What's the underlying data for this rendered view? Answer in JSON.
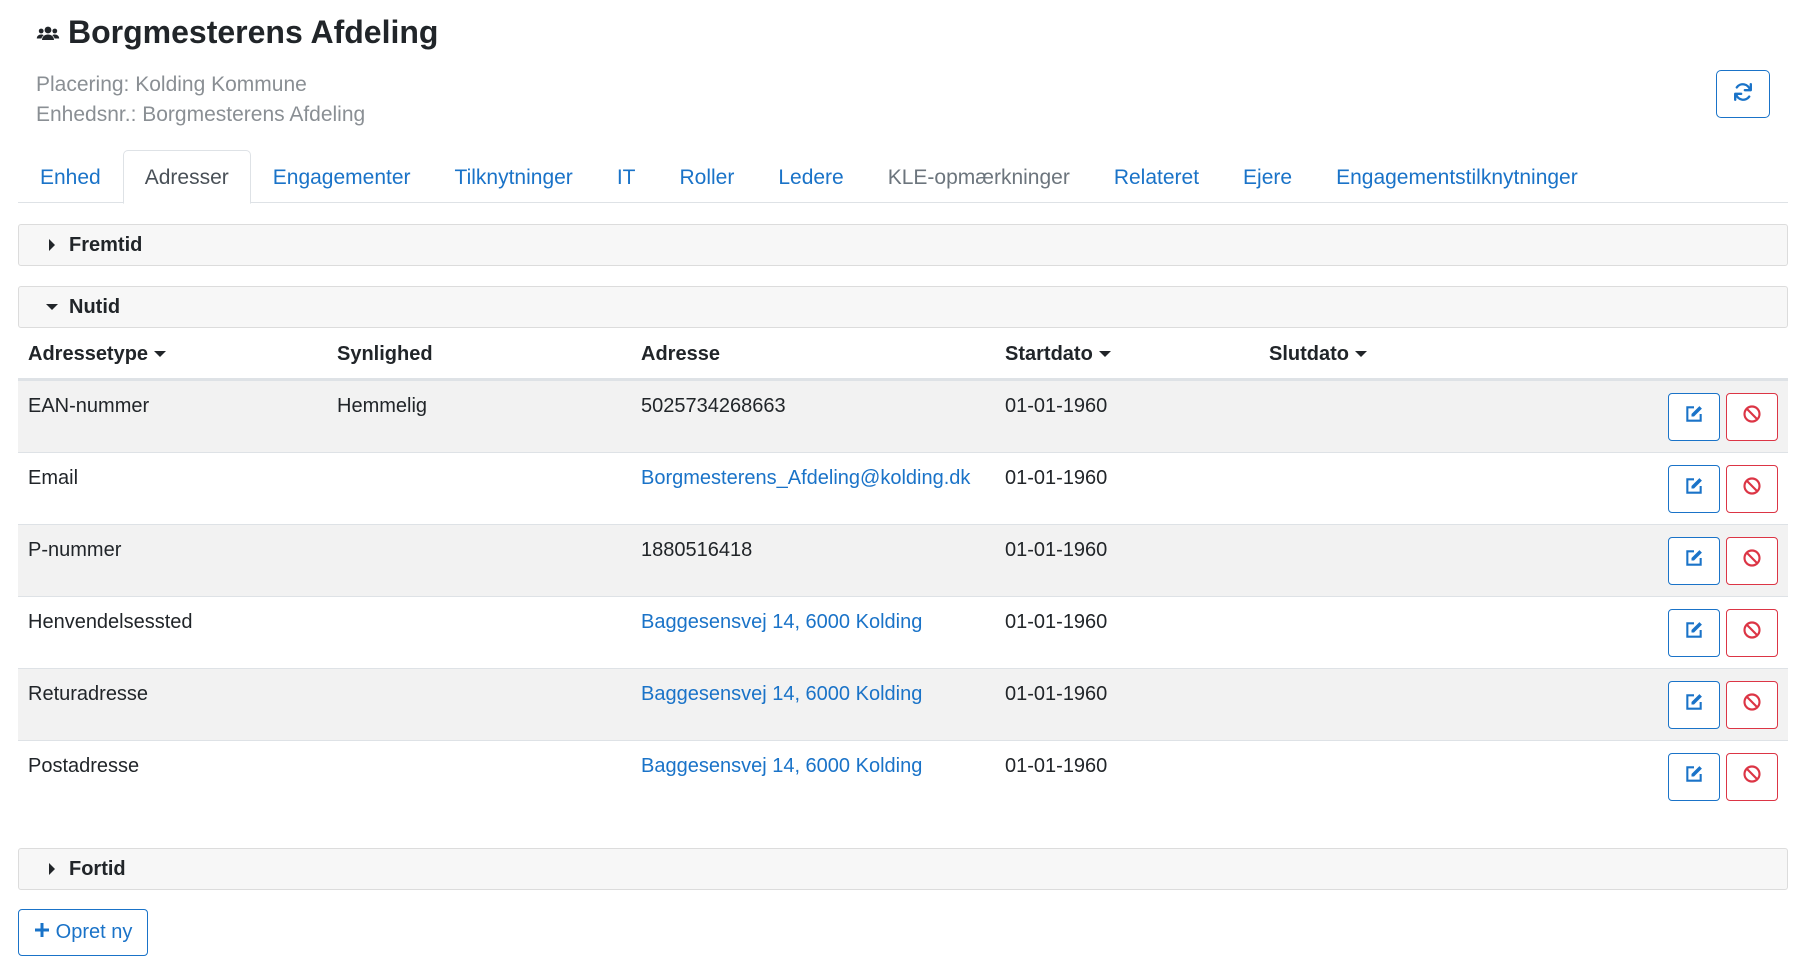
{
  "header": {
    "title": "Borgmesterens Afdeling",
    "placement": "Placering: Kolding Kommune",
    "unit_number": "Enhedsnr.: Borgmesterens Afdeling",
    "title_icon": "users-icon",
    "refresh_icon": "refresh-icon"
  },
  "tabs": [
    {
      "label": "Enhed"
    },
    {
      "label": "Adresser"
    },
    {
      "label": "Engagementer"
    },
    {
      "label": "Tilknytninger"
    },
    {
      "label": "IT"
    },
    {
      "label": "Roller"
    },
    {
      "label": "Ledere"
    },
    {
      "label": "KLE-opmærkninger"
    },
    {
      "label": "Relateret"
    },
    {
      "label": "Ejere"
    },
    {
      "label": "Engagementstilknytninger"
    }
  ],
  "active_tab": "Adresser",
  "sections": {
    "future": "Fremtid",
    "present": "Nutid",
    "past": "Fortid"
  },
  "table": {
    "headers": {
      "type": "Adressetype",
      "visibility": "Synlighed",
      "address": "Adresse",
      "start": "Startdato",
      "end": "Slutdato"
    },
    "rows": [
      {
        "type": "EAN-nummer",
        "visibility": "Hemmelig",
        "address": "5025734268663",
        "start": "01-01-1960",
        "end": ""
      },
      {
        "type": "Email",
        "visibility": "",
        "address": "Borgmesterens_Afdeling@kolding.dk",
        "start": "01-01-1960",
        "end": ""
      },
      {
        "type": "P-nummer",
        "visibility": "",
        "address": "1880516418",
        "start": "01-01-1960",
        "end": ""
      },
      {
        "type": "Henvendelsessted",
        "visibility": "",
        "address": "Baggesensvej 14, 6000 Kolding",
        "start": "01-01-1960",
        "end": ""
      },
      {
        "type": "Returadresse",
        "visibility": "",
        "address": "Baggesensvej 14, 6000 Kolding",
        "start": "01-01-1960",
        "end": ""
      },
      {
        "type": "Postadresse",
        "visibility": "",
        "address": "Baggesensvej 14, 6000 Kolding",
        "start": "01-01-1960",
        "end": ""
      }
    ]
  },
  "create_button": "Opret ny",
  "colors": {
    "link": "#1a73c8",
    "danger": "#dc3545",
    "muted": "#8a8f94",
    "section_bg": "#f7f7f7",
    "row_alt": "#f2f2f2"
  }
}
